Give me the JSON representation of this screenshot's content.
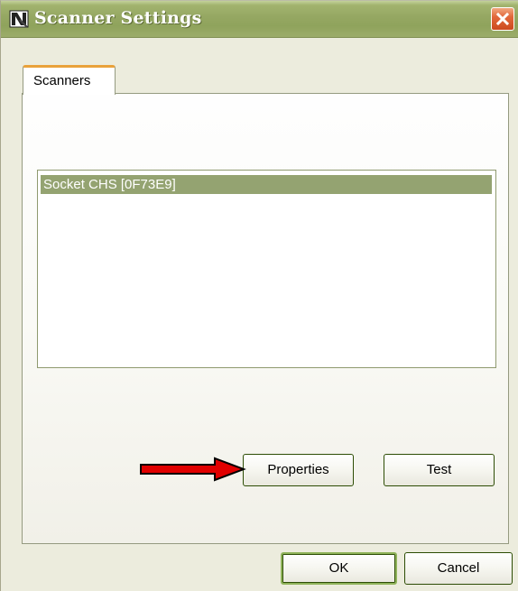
{
  "window": {
    "title": "Scanner Settings",
    "icon": "scanner-app-icon",
    "close_icon": "close-icon"
  },
  "tabs": [
    {
      "label": "Scanners",
      "active": true
    }
  ],
  "scanner_list": {
    "items": [
      {
        "label": "Socket CHS [0F73E9]",
        "selected": true
      }
    ]
  },
  "panel_buttons": {
    "properties": "Properties",
    "test": "Test"
  },
  "dialog_buttons": {
    "ok": "OK",
    "cancel": "Cancel"
  },
  "annotation": {
    "arrow_color": "#e00000",
    "arrow_target": "Properties"
  },
  "colors": {
    "titlebar": "#95a762",
    "selection": "#94a371",
    "tab_highlight": "#e9a23b",
    "close_button": "#e2683c"
  }
}
